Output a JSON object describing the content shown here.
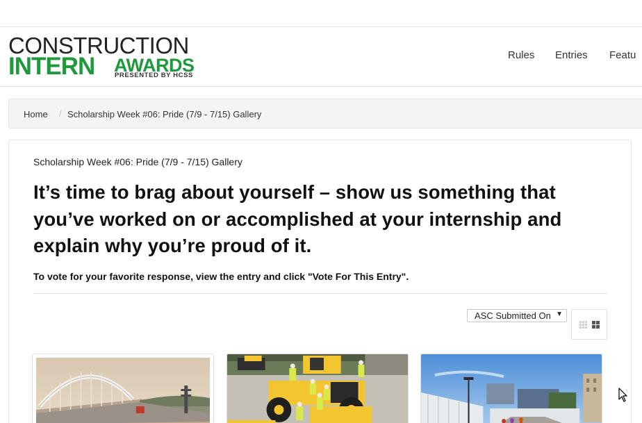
{
  "logo": {
    "line1": "CONSTRUCTION",
    "line2": "INTERN",
    "line3": "AWARDS",
    "line4": "PRESENTED BY HCSS",
    "brand_color": "#1e9a3c"
  },
  "nav": {
    "items": [
      {
        "label": "Rules"
      },
      {
        "label": "Entries"
      },
      {
        "label": "Featu"
      }
    ]
  },
  "breadcrumb": {
    "home": "Home",
    "separator": "/",
    "current": "Scholarship Week #06: Pride (7/9 - 7/15) Gallery"
  },
  "main": {
    "gallery_title": "Scholarship Week #06: Pride (7/9 - 7/15) Gallery",
    "headline": "It’s time to brag about yourself – show us something that you’ve worked on or accomplished at your internship and explain why you’re proud of it.",
    "instructions": "To vote for your favorite response, view the entry and click \"Vote For This Entry\"."
  },
  "controls": {
    "sort_selected": "ASC Submitted On",
    "view_small_icon": "grid-small-icon",
    "view_large_icon": "grid-large-icon"
  },
  "entries": [
    {
      "icon": "bridge-photo"
    },
    {
      "icon": "construction-crew-photo"
    },
    {
      "icon": "city-walkway-photo"
    }
  ]
}
